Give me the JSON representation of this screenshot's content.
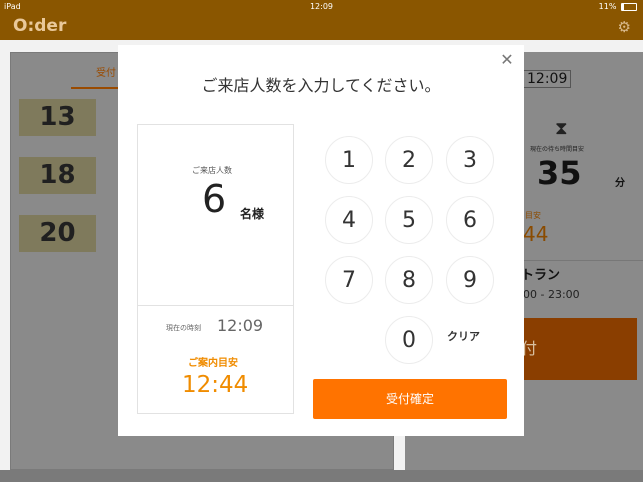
{
  "status": {
    "carrier": "iPad",
    "time": "12:09",
    "battery": "11%"
  },
  "header": {
    "logo": "O:der"
  },
  "background": {
    "tab_label": "受付",
    "queue_numbers": [
      "13",
      "18",
      "20"
    ],
    "current_time": "12:09",
    "wait_caption": "現在の待ち時間目安",
    "wait_value": "35",
    "wait_unit": "分",
    "guide_label": "目安",
    "guide_value": "44",
    "restaurant": "トラン",
    "hours": "00 - 23:00",
    "action_label": "付"
  },
  "modal": {
    "title": "ご来店人数を入力してください。",
    "count_label": "ご来店人数",
    "count_value": "6",
    "count_unit": "名様",
    "now_label": "現在の時刻",
    "now_value": "12:09",
    "guide_label": "ご案内目安",
    "guide_value": "12:44",
    "keys": [
      "1",
      "2",
      "3",
      "4",
      "5",
      "6",
      "7",
      "8",
      "9",
      "0"
    ],
    "clear_label": "クリア",
    "confirm_label": "受付確定"
  }
}
